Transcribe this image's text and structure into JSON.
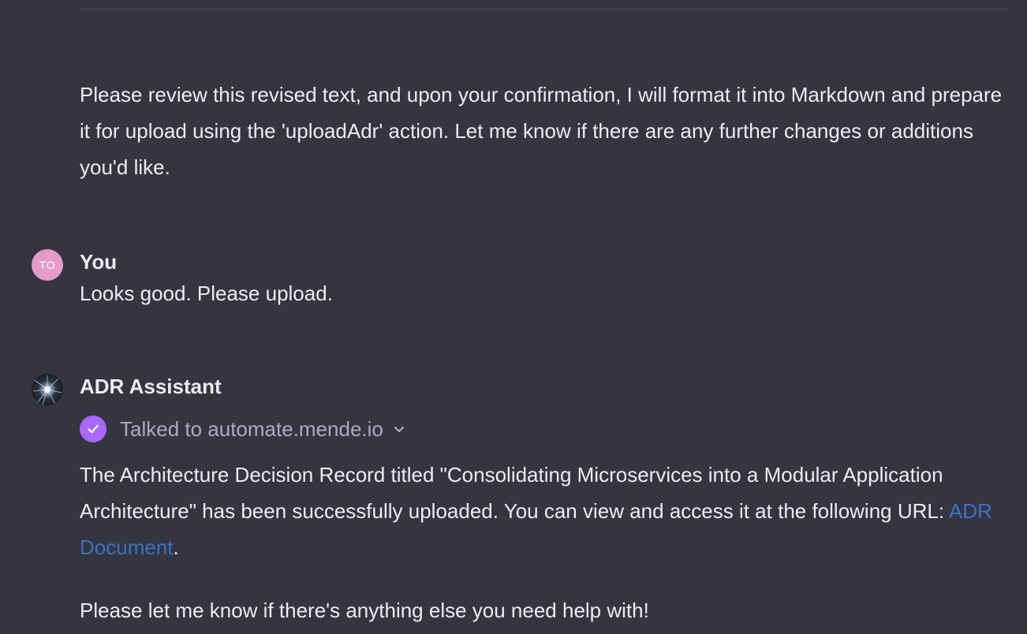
{
  "conversation": {
    "previous_message": {
      "text": "Please review this revised text, and upon your confirmation, I will format it into Markdown and prepare it for upload using the 'uploadAdr' action. Let me know if there are any further changes or additions you'd like."
    },
    "user_message": {
      "avatar_initials": "TO",
      "author": "You",
      "text": "Looks good. Please upload."
    },
    "assistant_message": {
      "author": "ADR Assistant",
      "tool_status": "Talked to automate.mende.io",
      "paragraph1_text": "The Architecture Decision Record titled \"Consolidating Microservices into a Modular Application Architecture\" has been successfully uploaded. You can view and access it at the following URL: ",
      "link_text": "ADR Document",
      "paragraph1_end": ".",
      "paragraph2_text": "Please let me know if there's anything else you need help with!"
    }
  },
  "colors": {
    "background": "#343541",
    "text": "#ececf1",
    "muted": "#acacbe",
    "link": "#3b72c4",
    "check_badge": "#ab68ff",
    "user_avatar": "#e59bc9"
  }
}
